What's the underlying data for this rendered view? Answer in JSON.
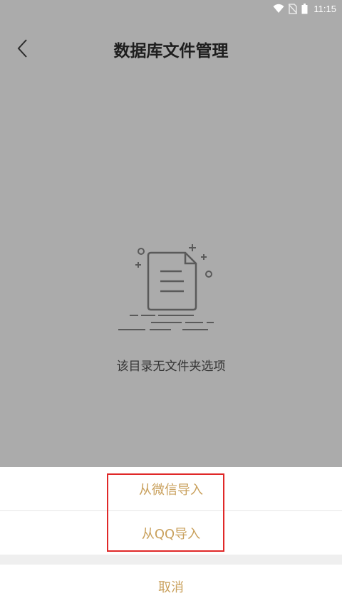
{
  "status_bar": {
    "time": "11:15"
  },
  "header": {
    "title": "数据库文件管理"
  },
  "empty_state": {
    "message": "该目录无文件夹选项"
  },
  "action_sheet": {
    "items": [
      {
        "label": "从微信导入"
      },
      {
        "label": "从QQ导入"
      }
    ],
    "cancel_label": "取消"
  },
  "colors": {
    "overlay_bg": "#ababab",
    "accent": "#c9a05c",
    "highlight": "#e02828"
  },
  "icons": [
    "wifi-icon",
    "no-sim-icon",
    "battery-icon",
    "back-arrow-icon",
    "empty-file-icon"
  ]
}
